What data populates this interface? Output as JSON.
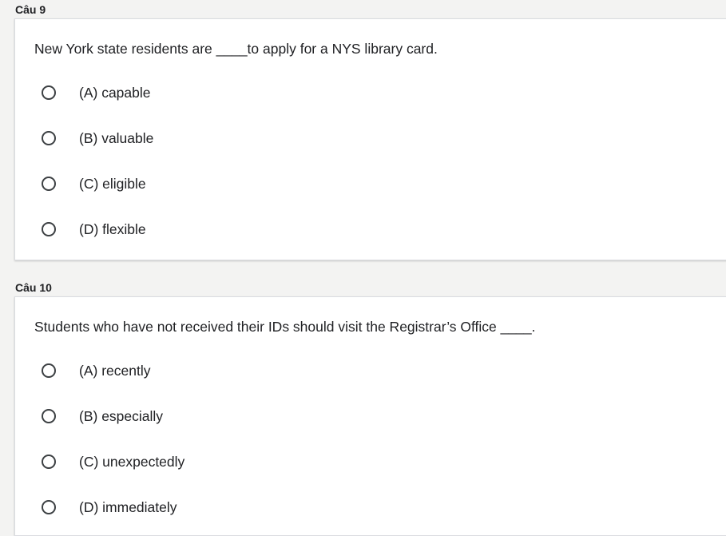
{
  "questions": [
    {
      "header": "Câu 9",
      "prompt": "New York state residents are ____to apply for a NYS library card.",
      "options": [
        "(A) capable",
        "(B) valuable",
        "(C) eligible",
        "(D) flexible"
      ]
    },
    {
      "header": "Câu 10",
      "prompt": "Students who have not received their IDs should visit the Registrar’s Office ____.",
      "options": [
        "(A) recently",
        "(B) especially",
        "(C) unexpectedly",
        "(D) immediately"
      ]
    }
  ]
}
